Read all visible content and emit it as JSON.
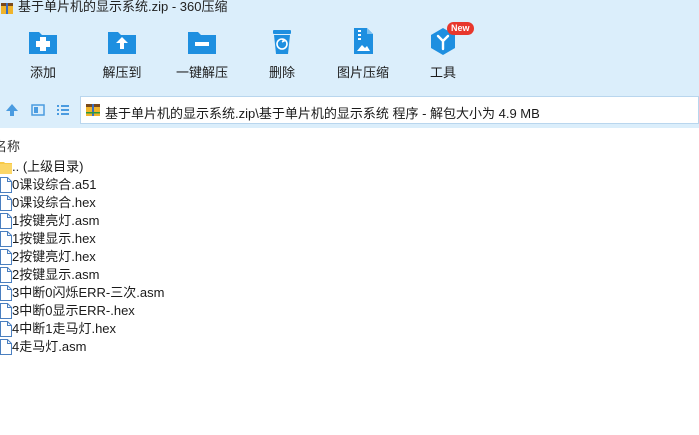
{
  "window": {
    "title": "基于单片机的显示系统.zip - 360压缩"
  },
  "toolbar": {
    "items": [
      {
        "label": "添加",
        "icon": "add-icon"
      },
      {
        "label": "解压到",
        "icon": "extract-to-icon"
      },
      {
        "label": "一键解压",
        "icon": "one-click-extract-icon"
      },
      {
        "label": "删除",
        "icon": "delete-icon"
      },
      {
        "label": "图片压缩",
        "icon": "image-compress-icon"
      },
      {
        "label": "工具",
        "icon": "tools-icon",
        "badge": "New"
      }
    ]
  },
  "address": {
    "path": "基于单片机的显示系统.zip\\基于单片机的显示系统 程序 - 解包大小为 4.9 MB"
  },
  "columns": {
    "name": "名称"
  },
  "files": [
    {
      "name": ".. (上级目录)",
      "type": "folder"
    },
    {
      "name": "0课设综合.a51",
      "type": "file"
    },
    {
      "name": "0课设综合.hex",
      "type": "file"
    },
    {
      "name": "1按键亮灯.asm",
      "type": "file"
    },
    {
      "name": "1按键显示.hex",
      "type": "file"
    },
    {
      "name": "2按键亮灯.hex",
      "type": "file"
    },
    {
      "name": "2按键显示.asm",
      "type": "file"
    },
    {
      "name": "3中断0闪烁ERR-三次.asm",
      "type": "file"
    },
    {
      "name": "3中断0显示ERR-.hex",
      "type": "file"
    },
    {
      "name": "4中断1走马灯.hex",
      "type": "file"
    },
    {
      "name": "4走马灯.asm",
      "type": "file"
    }
  ],
  "colors": {
    "chrome": "#dbeefb",
    "icon_blue": "#1e8fe0",
    "badge_red": "#e8372c"
  }
}
